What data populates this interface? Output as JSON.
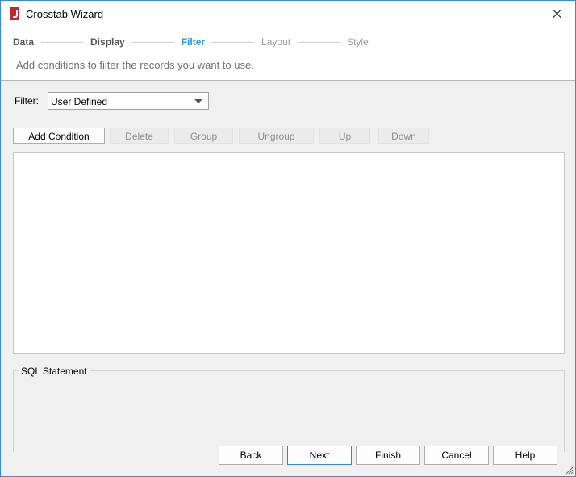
{
  "window": {
    "title": "Crosstab Wizard"
  },
  "steps": [
    {
      "label": "Data",
      "state": "done"
    },
    {
      "label": "Display",
      "state": "done"
    },
    {
      "label": "Filter",
      "state": "current"
    },
    {
      "label": "Layout",
      "state": "future"
    },
    {
      "label": "Style",
      "state": "future"
    }
  ],
  "description": "Add conditions to filter the records you want to use.",
  "filter": {
    "label": "Filter:",
    "value": "User Defined"
  },
  "toolbar": {
    "add_condition": "Add Condition",
    "delete": "Delete",
    "group": "Group",
    "ungroup": "Ungroup",
    "up": "Up",
    "down": "Down"
  },
  "sql": {
    "label": "SQL Statement"
  },
  "footer": {
    "back": "Back",
    "next": "Next",
    "finish": "Finish",
    "cancel": "Cancel",
    "help": "Help"
  },
  "colors": {
    "accent": "#2f96d4",
    "brand": "#c4262e",
    "border": "#3a8ccf"
  }
}
